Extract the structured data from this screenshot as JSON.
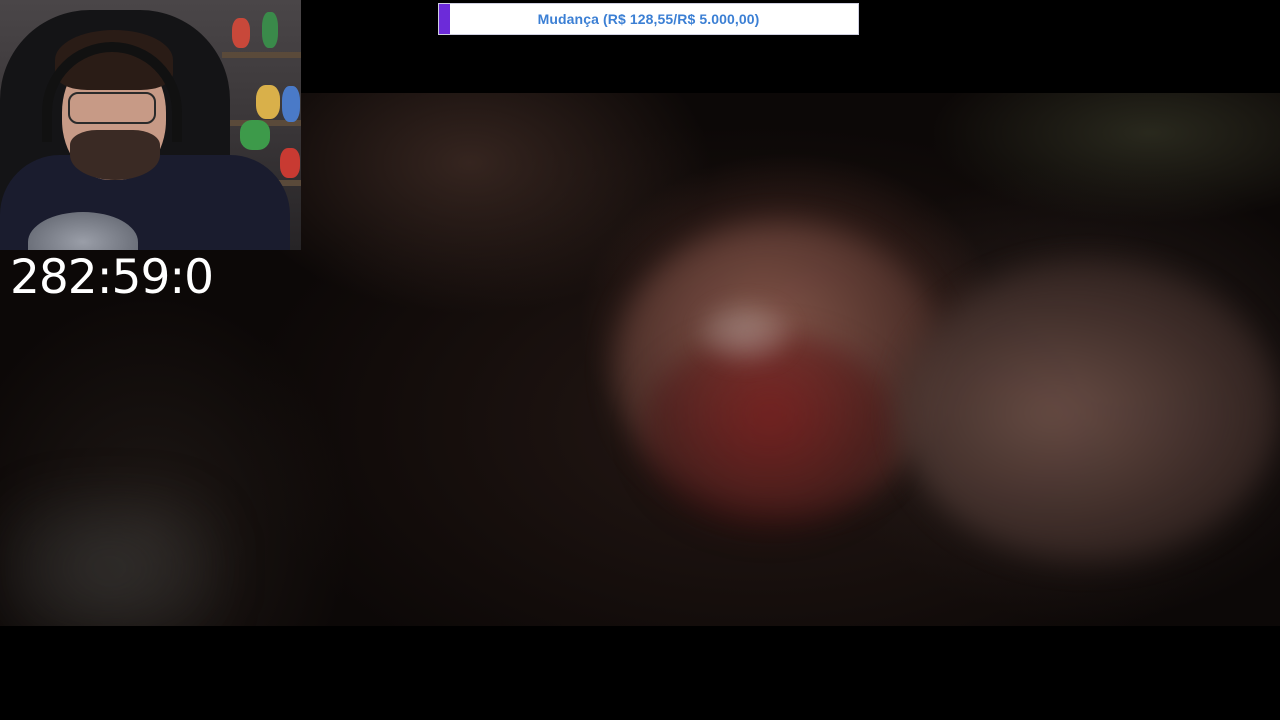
{
  "goal": {
    "text": "Mudança (R$ 128,55/R$ 5.000,00)",
    "current": 128.55,
    "target": 5000.0,
    "fill_color": "#6c2bd9",
    "text_color": "#3b7fd4",
    "background_color": "#ffffff"
  },
  "timer": {
    "text": "282:59:0"
  },
  "colors": {
    "background": "#000000",
    "timer_text": "#ffffff"
  }
}
